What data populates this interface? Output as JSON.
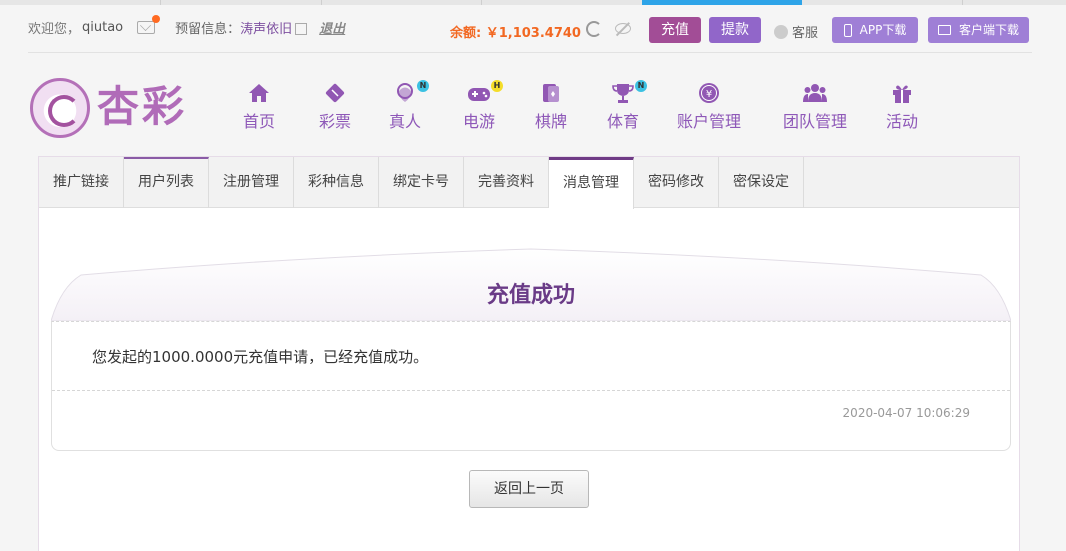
{
  "header": {
    "welcome": "欢迎您，",
    "username": "qiutao",
    "reserved_label": "预留信息：",
    "reserved_value": "涛声依旧",
    "logout": "退出",
    "balance_label": "余额:",
    "balance_value": "￥1,103.4740",
    "recharge": "充值",
    "withdraw": "提款",
    "service": "客服",
    "app_download": "APP下载",
    "client_download": "客户端下载"
  },
  "logo": {
    "text": "杏彩"
  },
  "nav": [
    {
      "label": "首页",
      "icon": "home-icon",
      "badge": ""
    },
    {
      "label": "彩票",
      "icon": "ticket-icon",
      "badge": ""
    },
    {
      "label": "真人",
      "icon": "dealer-icon",
      "badge": "N"
    },
    {
      "label": "电游",
      "icon": "gamepad-icon",
      "badge": "H"
    },
    {
      "label": "棋牌",
      "icon": "cards-icon",
      "badge": ""
    },
    {
      "label": "体育",
      "icon": "trophy-icon",
      "badge": "N"
    },
    {
      "label": "账户管理",
      "icon": "account-icon",
      "badge": ""
    },
    {
      "label": "团队管理",
      "icon": "team-icon",
      "badge": ""
    },
    {
      "label": "活动",
      "icon": "gift-icon",
      "badge": ""
    }
  ],
  "tabs": [
    "推广链接",
    "用户列表",
    "注册管理",
    "彩种信息",
    "绑定卡号",
    "完善资料",
    "消息管理",
    "密码修改",
    "密保设定"
  ],
  "message": {
    "title": "充值成功",
    "body": "您发起的1000.0000元充值申请，已经充值成功。",
    "timestamp": "2020-04-07 10:06:29",
    "back_button": "返回上一页"
  },
  "colors": {
    "accent": "#6f3b86",
    "brand": "#9157b3",
    "balance": "#f26822"
  }
}
